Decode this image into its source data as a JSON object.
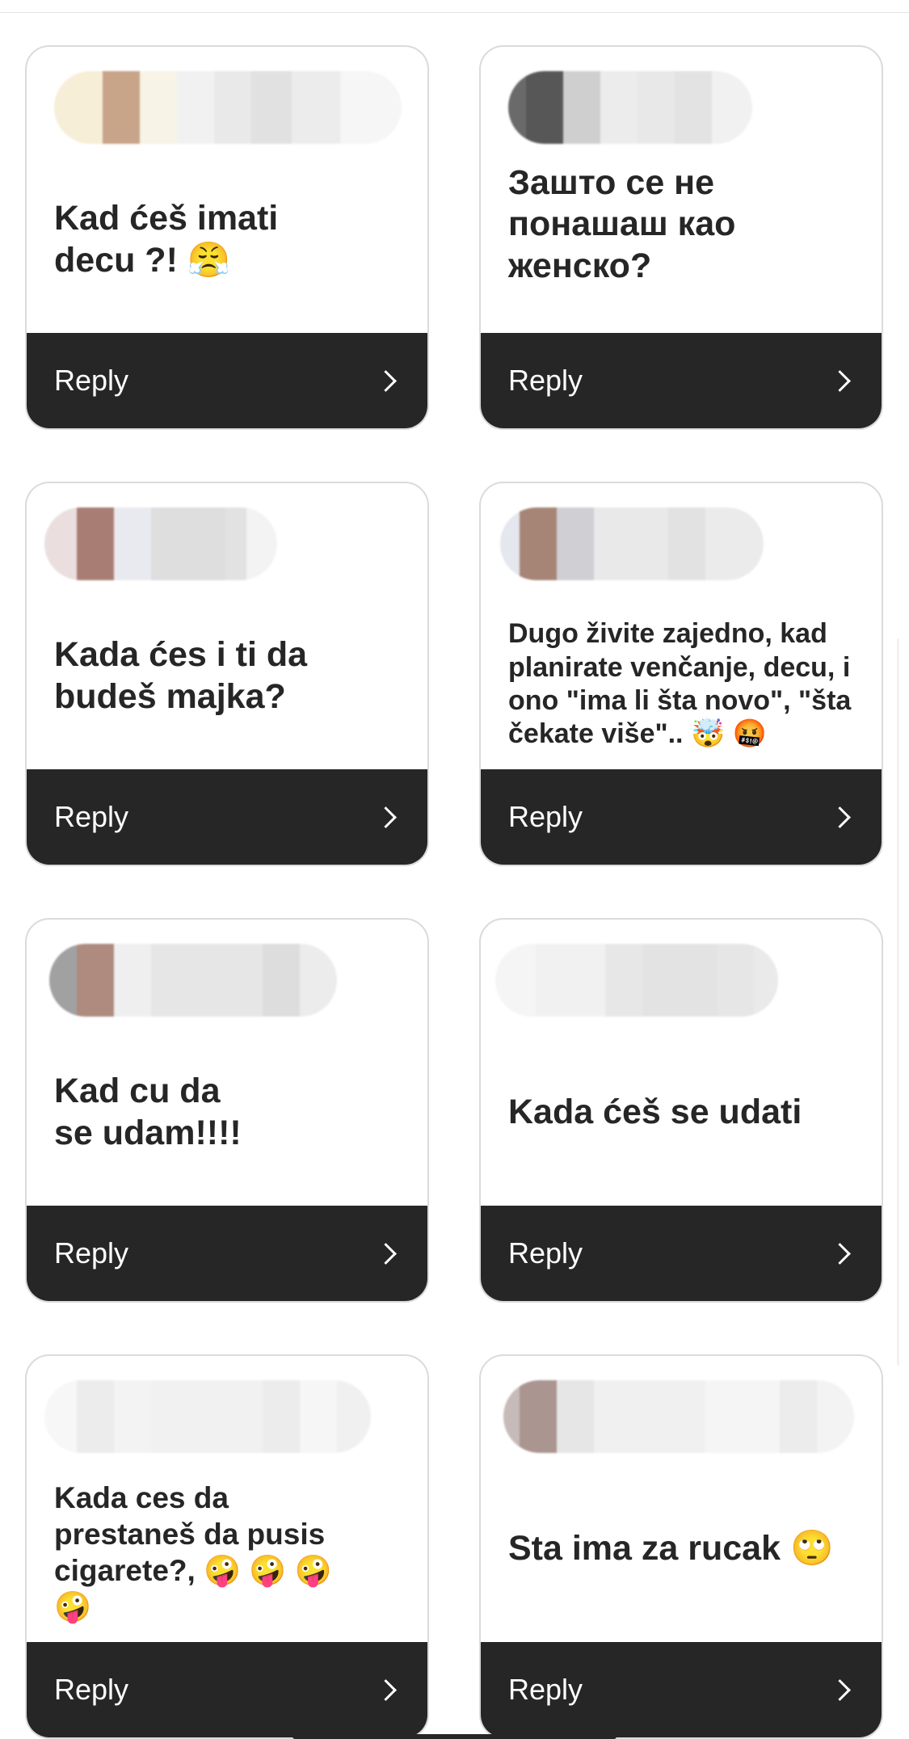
{
  "cards": [
    {
      "question": "Kad ćeš imati\ndecu ?! 😤",
      "reply_label": "Reply",
      "sender_colors": [
        "#f6eed7",
        "#c8a489",
        "#f7f3e7",
        "#f1f1f1",
        "#e9e9e9",
        "#e1e1e1",
        "#ececec",
        "#f6f6f6"
      ]
    },
    {
      "question": "Зашто се не\nпонашаш као\nженско?",
      "reply_label": "Reply",
      "sender_colors": [
        "#6a6a6a",
        "#575757",
        "#cfcfcf",
        "#ececec",
        "#e8e8e8",
        "#e3e3e3",
        "#f1f1f1"
      ]
    },
    {
      "question": "Kada ćes i ti da\nbudeš majka?",
      "reply_label": "Reply",
      "sender_colors": [
        "#eadede",
        "#a87e74",
        "#e9eaf0",
        "#dedede",
        "#e2e2e2",
        "#f3f3f3"
      ]
    },
    {
      "question": "Dugo živite zajedno, kad planirate venčanje, decu, i ono \"ima li šta novo\", \"šta čekate više\".. 🤯 🤬",
      "reply_label": "Reply",
      "sender_colors": [
        "#e4e7ee",
        "#a78576",
        "#cfcfd4",
        "#e9e9e9",
        "#e2e2e2",
        "#ebebeb"
      ]
    },
    {
      "question": "Kad cu da\nse udam!!!!",
      "reply_label": "Reply",
      "sender_colors": [
        "#a1a1a1",
        "#ae8a7f",
        "#efefef",
        "#e6e6e6",
        "#e9e9e9",
        "#dddddd",
        "#ececec"
      ]
    },
    {
      "question": "Kada ćeš se udati",
      "reply_label": "Reply",
      "sender_colors": [
        "#f5f5f5",
        "#f1f1f1",
        "#e7e7e7",
        "#e3e3e3",
        "#e6e6e6",
        "#eaeaea"
      ]
    },
    {
      "question": "Kada ces da\nprestaneš da pusis\ncigarete?, 🤪 🤪 🤪\n🤪",
      "reply_label": "Reply",
      "sender_colors": [
        "#f7f7f7",
        "#ececec",
        "#f3f3f3",
        "#f1f1f1",
        "#ececec",
        "#f6f6f6",
        "#f0f0f0"
      ]
    },
    {
      "question": "Sta ima za rucak 🙄",
      "reply_label": "Reply",
      "sender_colors": [
        "#c6bbb8",
        "#ab9590",
        "#e6e6e6",
        "#f0f0f0",
        "#f5f5f5",
        "#ececec",
        "#f3f3f3"
      ]
    }
  ]
}
